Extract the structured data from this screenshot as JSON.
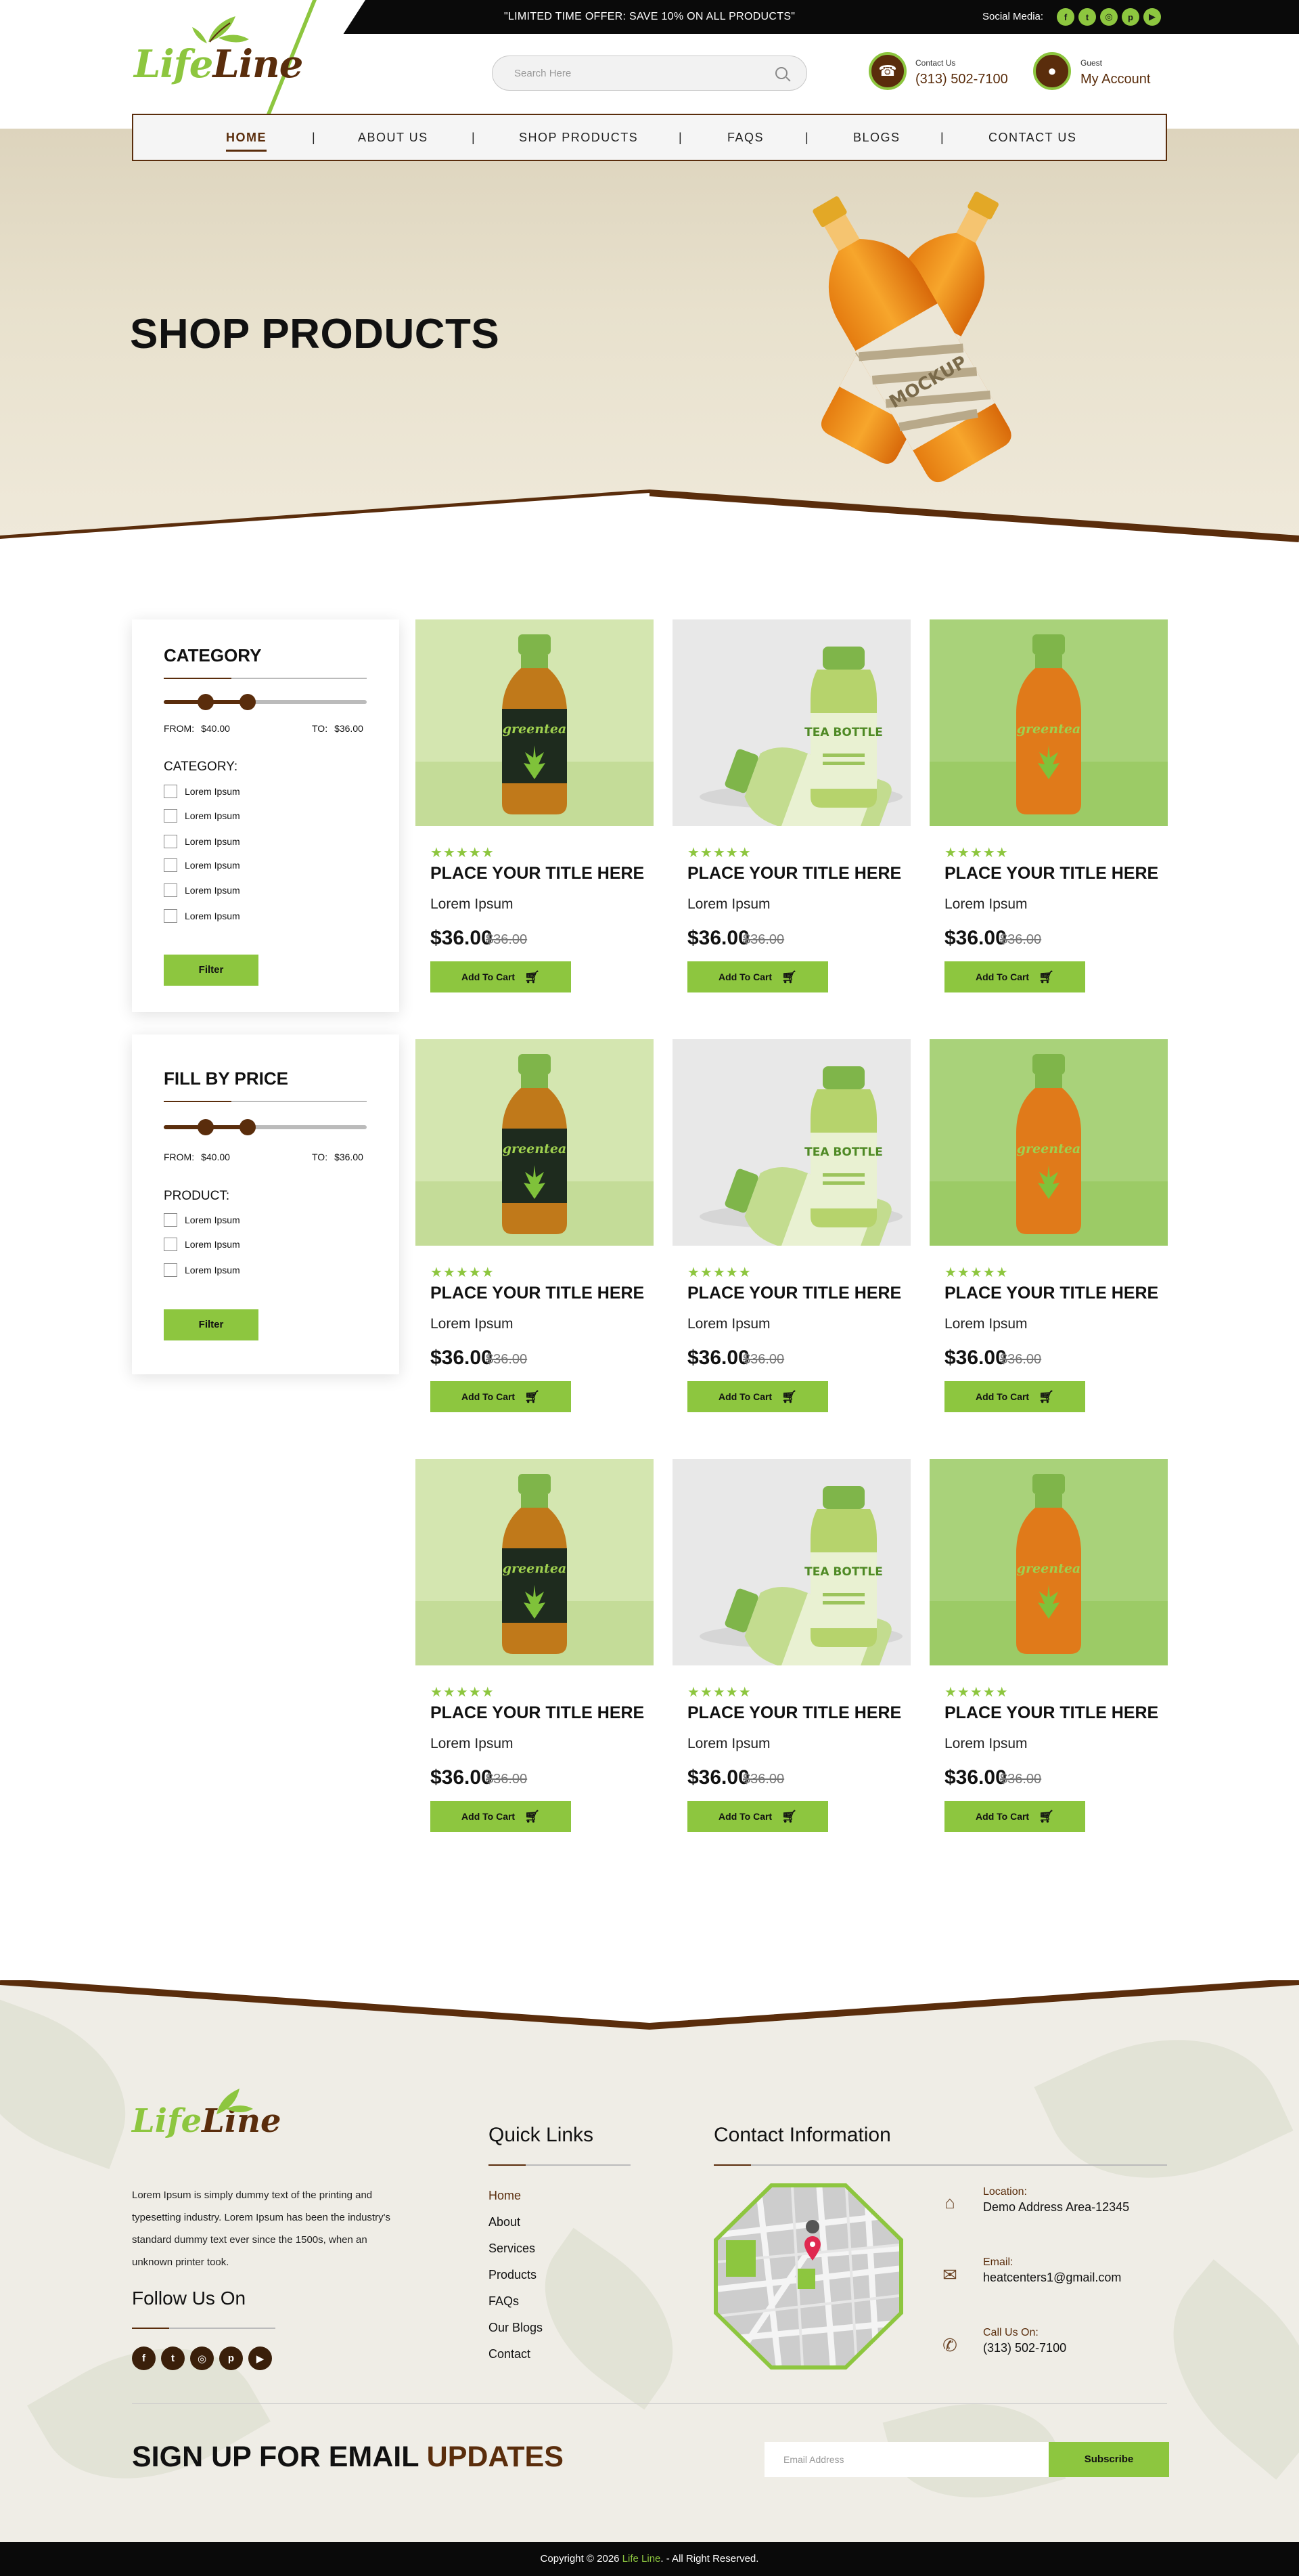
{
  "topbar": {
    "offer": "\"LIMITED TIME OFFER: SAVE 10% ON ALL PRODUCTS\"",
    "social_label": "Social Media:",
    "social_icons": [
      "f",
      "t",
      "◎",
      "p",
      "▶"
    ]
  },
  "brand": {
    "logo_part1": "Life",
    "logo_part2": "Line"
  },
  "search": {
    "placeholder": "Search Here"
  },
  "contact": {
    "label": "Contact Us",
    "phone": "(313) 502-7100"
  },
  "account": {
    "label": "Guest",
    "title": "My Account"
  },
  "nav": {
    "items": [
      "HOME",
      "ABOUT US",
      "SHOP PRODUCTS",
      "FAQS",
      "BLOGS",
      "CONTACT US"
    ],
    "separator": "|"
  },
  "hero": {
    "title": "SHOP PRODUCTS",
    "bottle_label": "MOCKUP"
  },
  "filters": {
    "category_panel": {
      "title": "CATEGORY",
      "from_label": "FROM:",
      "from_value": "$40.00",
      "to_label": "TO:",
      "to_value": "$36.00",
      "list_title": "CATEGORY:",
      "options": [
        "Lorem Ipsum",
        "Lorem Ipsum",
        "Lorem Ipsum",
        "Lorem Ipsum",
        "Lorem Ipsum",
        "Lorem Ipsum"
      ],
      "button": "Filter"
    },
    "price_panel": {
      "title": "FILL BY PRICE",
      "from_label": "FROM:",
      "from_value": "$40.00",
      "to_label": "TO:",
      "to_value": "$36.00",
      "list_title": "PRODUCT:",
      "options": [
        "Lorem Ipsum",
        "Lorem Ipsum",
        "Lorem Ipsum"
      ],
      "button": "Filter"
    }
  },
  "products": [
    {
      "title": "PLACE YOUR TITLE HERE",
      "subtitle": "Lorem Ipsum",
      "price": "$36.00",
      "old_price": "$36.00",
      "rating": "★★★★★",
      "button": "Add To Cart",
      "label": "greentea"
    },
    {
      "title": "PLACE YOUR TITLE HERE",
      "subtitle": "Lorem Ipsum",
      "price": "$36.00",
      "old_price": "$36.00",
      "rating": "★★★★★",
      "button": "Add To Cart",
      "label": "TEA BOTTLE"
    },
    {
      "title": "PLACE YOUR TITLE HERE",
      "subtitle": "Lorem Ipsum",
      "price": "$36.00",
      "old_price": "$36.00",
      "rating": "★★★★★",
      "button": "Add To Cart",
      "label": "greentea"
    },
    {
      "title": "PLACE YOUR TITLE HERE",
      "subtitle": "Lorem Ipsum",
      "price": "$36.00",
      "old_price": "$36.00",
      "rating": "★★★★★",
      "button": "Add To Cart",
      "label": "greentea"
    },
    {
      "title": "PLACE YOUR TITLE HERE",
      "subtitle": "Lorem Ipsum",
      "price": "$36.00",
      "old_price": "$36.00",
      "rating": "★★★★★",
      "button": "Add To Cart",
      "label": "TEA BOTTLE"
    },
    {
      "title": "PLACE YOUR TITLE HERE",
      "subtitle": "Lorem Ipsum",
      "price": "$36.00",
      "old_price": "$36.00",
      "rating": "★★★★★",
      "button": "Add To Cart",
      "label": "greentea"
    },
    {
      "title": "PLACE YOUR TITLE HERE",
      "subtitle": "Lorem Ipsum",
      "price": "$36.00",
      "old_price": "$36.00",
      "rating": "★★★★★",
      "button": "Add To Cart",
      "label": "greentea"
    },
    {
      "title": "PLACE YOUR TITLE HERE",
      "subtitle": "Lorem Ipsum",
      "price": "$36.00",
      "old_price": "$36.00",
      "rating": "★★★★★",
      "button": "Add To Cart",
      "label": "TEA BOTTLE"
    },
    {
      "title": "PLACE YOUR TITLE HERE",
      "subtitle": "Lorem Ipsum",
      "price": "$36.00",
      "old_price": "$36.00",
      "rating": "★★★★★",
      "button": "Add To Cart",
      "label": "greentea"
    }
  ],
  "footer": {
    "about": "Lorem Ipsum is simply dummy text of the printing and typesetting industry. Lorem Ipsum has been the industry's standard dummy text ever since the 1500s, when an unknown printer took.",
    "follow_title": "Follow Us On",
    "follow_icons": [
      "f",
      "t",
      "◎",
      "p",
      "▶"
    ],
    "quick_links_title": "Quick Links",
    "quick_links": [
      "Home",
      "About",
      "Services",
      "Products",
      "FAQs",
      "Our Blogs",
      "Contact"
    ],
    "contact_title": "Contact Information",
    "location_label": "Location:",
    "location_value": "Demo Address Area-12345",
    "email_label": "Email:",
    "email_value": "heatcenters1@gmail.com",
    "call_label": "Call Us On:",
    "call_value": "(313) 502-7100",
    "signup_part1": "SIGN UP FOR EMAIL ",
    "signup_part2": "UPDATES",
    "email_placeholder": "Email Address",
    "subscribe": "Subscribe",
    "copyright_pre": "Copyright © 2026 ",
    "copyright_brand": "Life Line",
    "copyright_post": ". - All Right Reserved."
  },
  "colors": {
    "green": "#8dc63f",
    "brown": "#5a2d0c",
    "black": "#0a0a0a",
    "beige": "#e8e1cd"
  }
}
